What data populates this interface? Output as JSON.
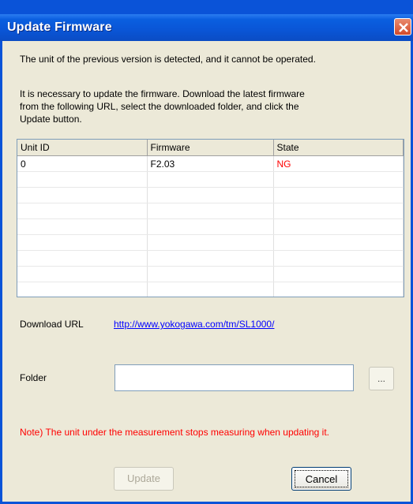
{
  "window": {
    "title": "Update Firmware"
  },
  "messages": {
    "detected": "The unit of the previous version is detected, and it cannot be operated.",
    "instructions_line1": "It is necessary to update the firmware. Download the latest firmware",
    "instructions_line2": "from the following URL, select the downloaded folder, and click the",
    "instructions_line3": "Update button.",
    "note": "Note) The unit under the measurement stops measuring when updating it."
  },
  "grid": {
    "columns": [
      "Unit ID",
      "Firmware",
      "State"
    ],
    "rows": [
      {
        "unit_id": "0",
        "firmware": "F2.03",
        "state": "NG"
      }
    ]
  },
  "download": {
    "label": "Download URL",
    "url": "http://www.yokogawa.com/tm/SL1000/"
  },
  "folder": {
    "label": "Folder",
    "value": "",
    "browse_label": "..."
  },
  "buttons": {
    "update": "Update",
    "cancel": "Cancel"
  },
  "colors": {
    "title_bar": "#0a55d6",
    "dialog_bg": "#ece9d8",
    "state_ng": "#ff0000",
    "link": "#0000ff"
  }
}
